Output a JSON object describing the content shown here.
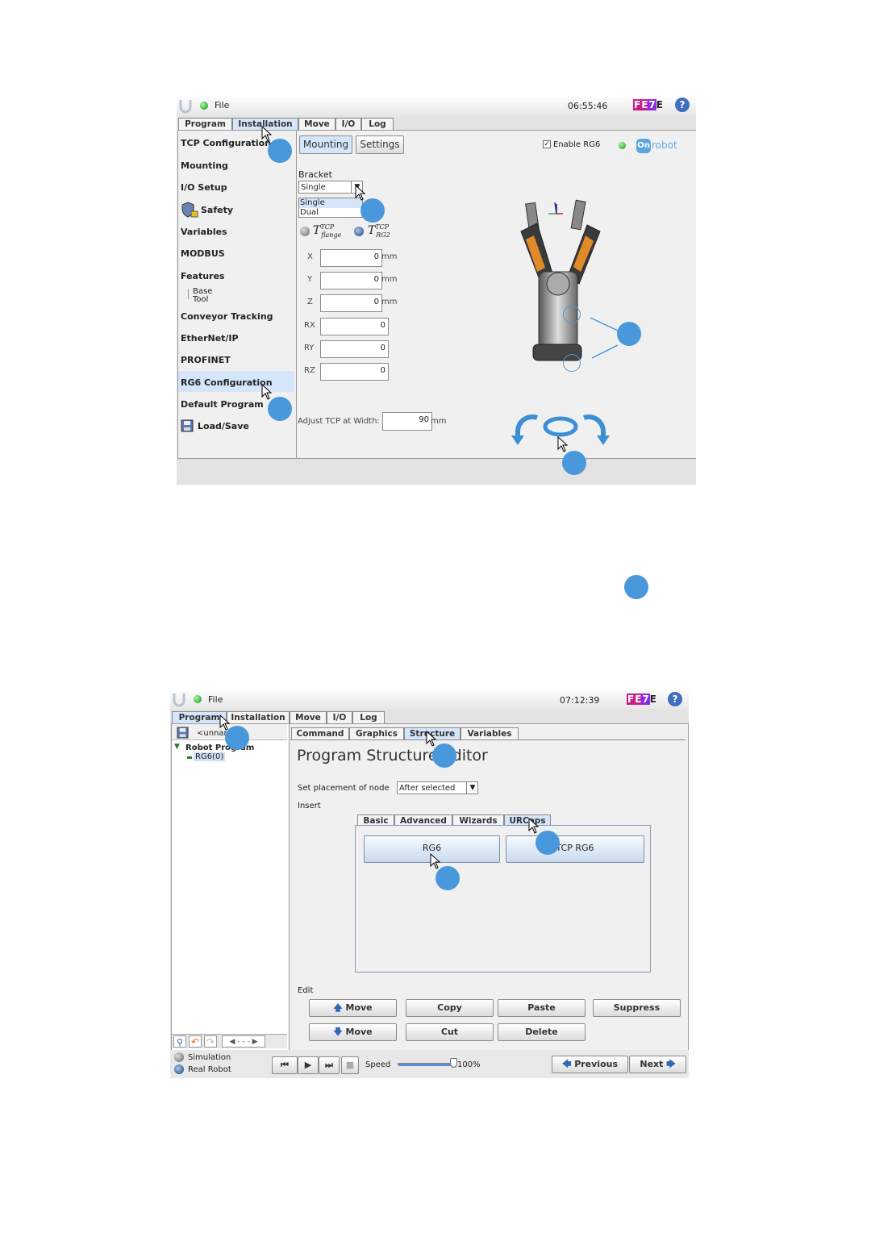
{
  "screen1": {
    "topbar": {
      "menu": "File",
      "clock": "06:55:46",
      "logo_text": "FE7E",
      "help": "?"
    },
    "tabs": [
      "Program",
      "Installation",
      "Move",
      "I/O",
      "Log"
    ],
    "nav": [
      "TCP Configuration",
      "Mounting",
      "I/O Setup",
      "Safety",
      "Variables",
      "MODBUS",
      "Features",
      "Conveyor Tracking",
      "EtherNet/IP",
      "PROFINET",
      "RG6 Configuration",
      "Default Program",
      "Load/Save"
    ],
    "features_sub": [
      "Base",
      "Tool"
    ],
    "subtabs": [
      "Mounting",
      "Settings"
    ],
    "enable_label": "Enable RG6",
    "brand": "robot",
    "brand_badge": "On",
    "bracket_label": "Bracket",
    "bracket_value": "Single",
    "bracket_options": [
      "Single",
      "Dual"
    ],
    "tcp_flange": "T",
    "tcp_flange_sup": "TCP",
    "tcp_flange_sub": "flange",
    "tcp_rg_sup": "TCP",
    "tcp_rg_sub": "RG2",
    "fields": [
      {
        "label": "X",
        "value": "0",
        "unit": "mm"
      },
      {
        "label": "Y",
        "value": "0",
        "unit": "mm"
      },
      {
        "label": "Z",
        "value": "0",
        "unit": "mm"
      },
      {
        "label": "RX",
        "value": "0",
        "unit": ""
      },
      {
        "label": "RY",
        "value": "0",
        "unit": ""
      },
      {
        "label": "RZ",
        "value": "0",
        "unit": ""
      }
    ],
    "adjust_label": "Adjust TCP at Width:",
    "adjust_value": "90",
    "adjust_unit": "mm"
  },
  "screen2": {
    "topbar": {
      "menu": "File",
      "clock": "07:12:39",
      "logo_text": "FE7E",
      "help": "?"
    },
    "tabs": [
      "Program",
      "Installation",
      "Move",
      "I/O",
      "Log"
    ],
    "file_name": "<unnan",
    "tree_root": "Robot Program",
    "tree_node": "RG6(0)",
    "subtabs": [
      "Command",
      "Graphics",
      "Structure",
      "Variables"
    ],
    "title": "Program Structure Editor",
    "placement_label": "Set placement of node",
    "placement_value": "After selected",
    "insert_label": "Insert",
    "insert_tabs": [
      "Basic",
      "Advanced",
      "Wizards",
      "URCaps"
    ],
    "urcap_buttons": [
      "RG6",
      "TCP RG6"
    ],
    "edit_label": "Edit",
    "edit_buttons": [
      "Move",
      "Copy",
      "Paste",
      "Suppress",
      "Move",
      "Cut",
      "Delete"
    ],
    "sim_label": "Simulation",
    "real_label": "Real Robot",
    "speed_label": "Speed",
    "speed_value": "100%",
    "speed_fraction": 1.0,
    "prev_label": "Previous",
    "next_label": "Next"
  },
  "colors": {
    "marker": "#4a98dc",
    "accent_blue": "#3c8fd6",
    "active_tab": "#d5e6fb"
  }
}
